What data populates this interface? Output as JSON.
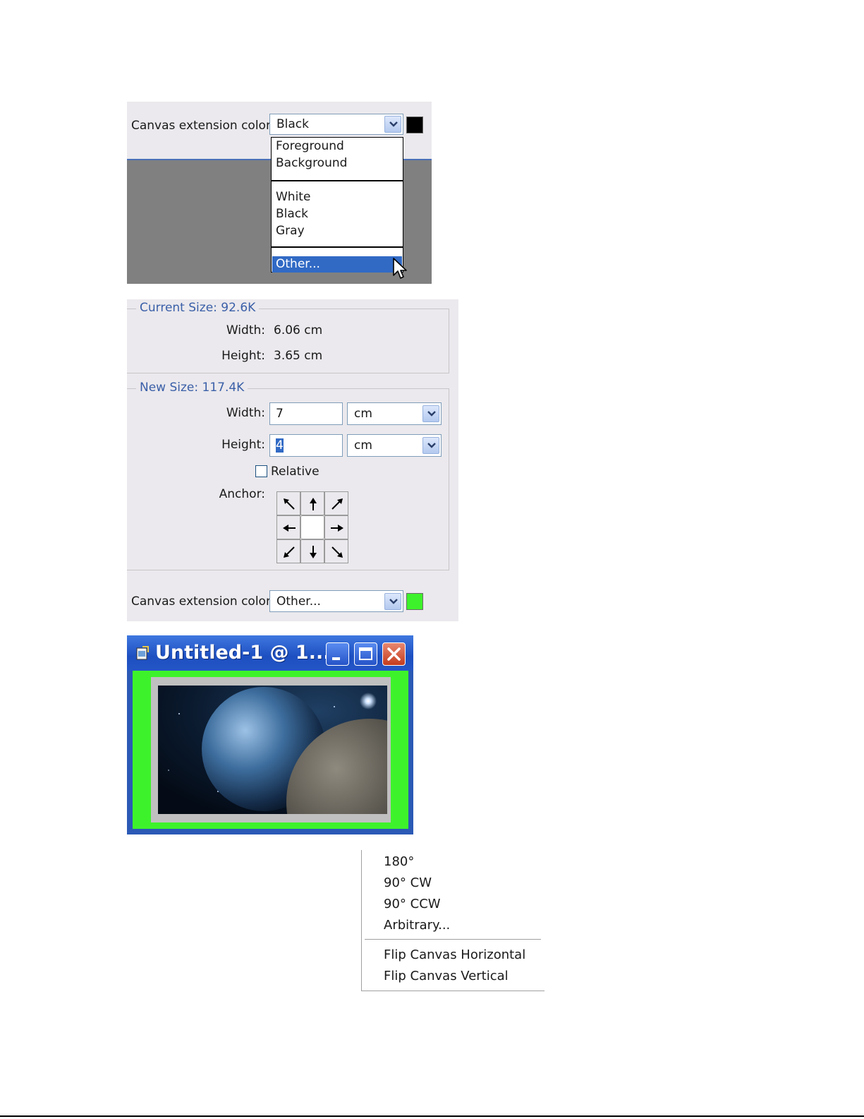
{
  "panel1": {
    "label": "Canvas extension color:",
    "selected_value": "Black",
    "swatch_color": "#000000",
    "options_group1": [
      "Foreground",
      "Background"
    ],
    "options_group2": [
      "White",
      "Black",
      "Gray"
    ],
    "highlighted_option": "Other..."
  },
  "panel2": {
    "current_size": {
      "legend": "Current Size: 92.6K",
      "width_label": "Width:",
      "width_value": "6.06 cm",
      "height_label": "Height:",
      "height_value": "3.65 cm"
    },
    "new_size": {
      "legend": "New Size: 117.4K",
      "width_label": "Width:",
      "width_value": "7",
      "width_unit": "cm",
      "height_label": "Height:",
      "height_value": "4",
      "height_unit": "cm",
      "relative_label": "Relative",
      "relative_checked": false,
      "anchor_label": "Anchor:",
      "anchor_selected": "center"
    },
    "extension": {
      "label": "Canvas extension color:",
      "selected_value": "Other...",
      "swatch_color": "#3ef22b"
    }
  },
  "panel3": {
    "window_title": "Untitled-1 @ 1...",
    "extension_color": "#3ef22b"
  },
  "panel4": {
    "items": [
      "180°",
      "90° CW",
      "90° CCW",
      "Arbitrary..."
    ],
    "flip_items": [
      "Flip Canvas Horizontal",
      "Flip Canvas Vertical"
    ]
  }
}
